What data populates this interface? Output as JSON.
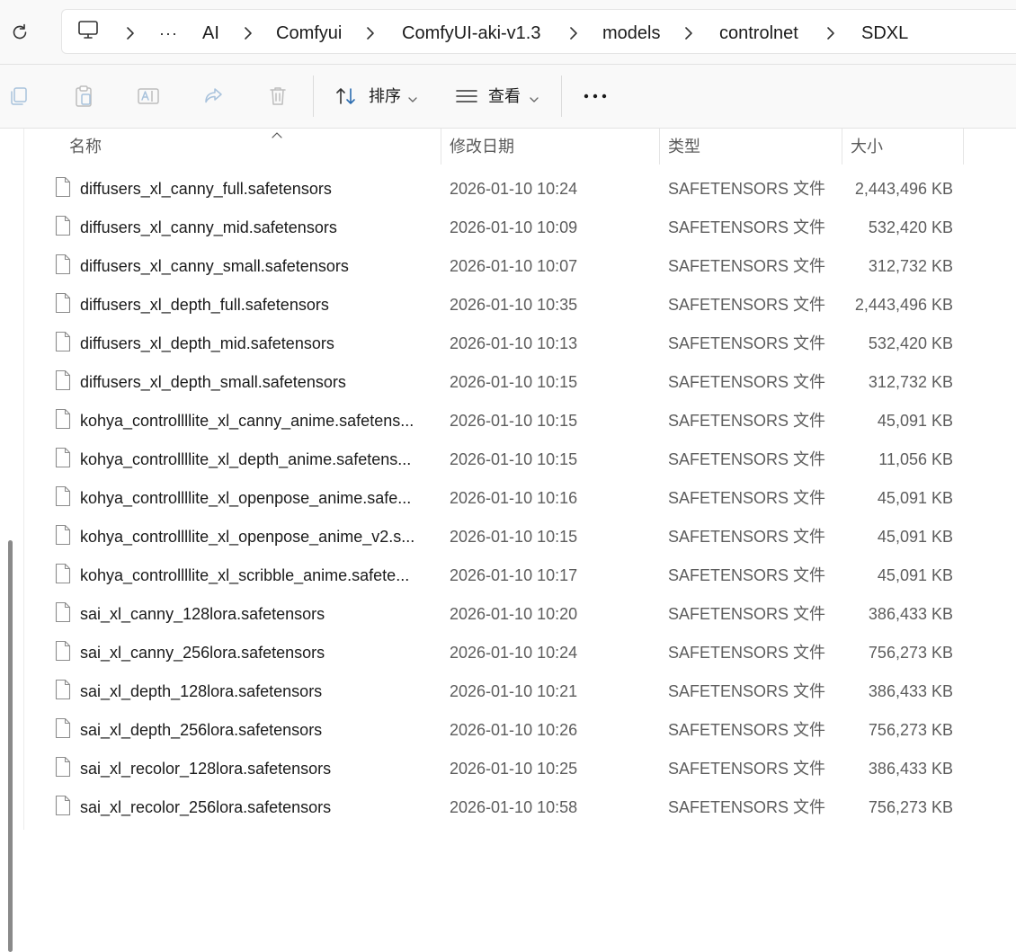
{
  "breadcrumb": {
    "overflow": "···",
    "items": [
      "AI",
      "Comfyui",
      "ComfyUI-aki-v1.3",
      "models",
      "controlnet",
      "SDXL"
    ]
  },
  "toolbar": {
    "sort_label": "排序",
    "view_label": "查看",
    "more": "···"
  },
  "columns": {
    "name": "名称",
    "date": "修改日期",
    "type": "类型",
    "size": "大小"
  },
  "files": [
    {
      "name": "diffusers_xl_canny_full.safetensors",
      "date": "2026-01-10 10:24",
      "type": "SAFETENSORS 文件",
      "size": "2,443,496 KB"
    },
    {
      "name": "diffusers_xl_canny_mid.safetensors",
      "date": "2026-01-10 10:09",
      "type": "SAFETENSORS 文件",
      "size": "532,420 KB"
    },
    {
      "name": "diffusers_xl_canny_small.safetensors",
      "date": "2026-01-10 10:07",
      "type": "SAFETENSORS 文件",
      "size": "312,732 KB"
    },
    {
      "name": "diffusers_xl_depth_full.safetensors",
      "date": "2026-01-10 10:35",
      "type": "SAFETENSORS 文件",
      "size": "2,443,496 KB"
    },
    {
      "name": "diffusers_xl_depth_mid.safetensors",
      "date": "2026-01-10 10:13",
      "type": "SAFETENSORS 文件",
      "size": "532,420 KB"
    },
    {
      "name": "diffusers_xl_depth_small.safetensors",
      "date": "2026-01-10 10:15",
      "type": "SAFETENSORS 文件",
      "size": "312,732 KB"
    },
    {
      "name": "kohya_controllllite_xl_canny_anime.safetens...",
      "date": "2026-01-10 10:15",
      "type": "SAFETENSORS 文件",
      "size": "45,091 KB"
    },
    {
      "name": "kohya_controllllite_xl_depth_anime.safetens...",
      "date": "2026-01-10 10:15",
      "type": "SAFETENSORS 文件",
      "size": "11,056 KB"
    },
    {
      "name": "kohya_controllllite_xl_openpose_anime.safe...",
      "date": "2026-01-10 10:16",
      "type": "SAFETENSORS 文件",
      "size": "45,091 KB"
    },
    {
      "name": "kohya_controllllite_xl_openpose_anime_v2.s...",
      "date": "2026-01-10 10:15",
      "type": "SAFETENSORS 文件",
      "size": "45,091 KB"
    },
    {
      "name": "kohya_controllllite_xl_scribble_anime.safete...",
      "date": "2026-01-10 10:17",
      "type": "SAFETENSORS 文件",
      "size": "45,091 KB"
    },
    {
      "name": "sai_xl_canny_128lora.safetensors",
      "date": "2026-01-10 10:20",
      "type": "SAFETENSORS 文件",
      "size": "386,433 KB"
    },
    {
      "name": "sai_xl_canny_256lora.safetensors",
      "date": "2026-01-10 10:24",
      "type": "SAFETENSORS 文件",
      "size": "756,273 KB"
    },
    {
      "name": "sai_xl_depth_128lora.safetensors",
      "date": "2026-01-10 10:21",
      "type": "SAFETENSORS 文件",
      "size": "386,433 KB"
    },
    {
      "name": "sai_xl_depth_256lora.safetensors",
      "date": "2026-01-10 10:26",
      "type": "SAFETENSORS 文件",
      "size": "756,273 KB"
    },
    {
      "name": "sai_xl_recolor_128lora.safetensors",
      "date": "2026-01-10 10:25",
      "type": "SAFETENSORS 文件",
      "size": "386,433 KB"
    },
    {
      "name": "sai_xl_recolor_256lora.safetensors",
      "date": "2026-01-10 10:58",
      "type": "SAFETENSORS 文件",
      "size": "756,273 KB"
    }
  ]
}
